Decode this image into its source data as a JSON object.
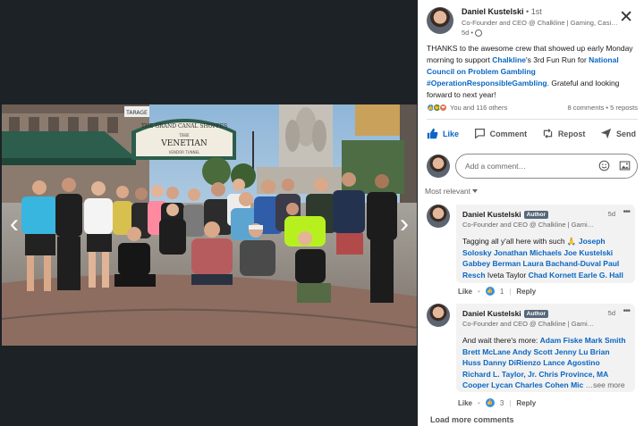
{
  "post": {
    "author_name": "Daniel Kustelski",
    "degree": "• 1st",
    "subtitle": "Co-Founder and CEO @ Chalkline | Gaming, Casino…",
    "time": "5d •",
    "text_1": "THANKS to the awesome crew that showed up early Monday morning to support ",
    "tag_company": "Chalkline",
    "text_2": "'s 3rd Fun Run for ",
    "tag_org": "National Council on Problem Gambling",
    "tag_hashtag": "#OperationResponsibleGambling",
    "text_3": ". Grateful and looking forward to next year!",
    "reactions_text": "You and 116 others",
    "counts_text": "8 comments • 5 reposts"
  },
  "actions": {
    "like": "Like",
    "comment": "Comment",
    "repost": "Repost",
    "send": "Send"
  },
  "composer": {
    "placeholder": "Add a comment…"
  },
  "sort_label": "Most relevant",
  "comments": [
    {
      "name": "Daniel Kustelski",
      "badge": "Author",
      "time": "5d",
      "subtitle": "Co-Founder and CEO @ Chalkline | Gaming…",
      "lead": "Tagging all y'all here with such 🙏 ",
      "tags_a": "Joseph Solosky Jonathan Michaels Joe Kustelski Gabbey Berman Laura Bachand-Duval Paul Resch",
      "plain": " Iveta Taylor ",
      "tags_b": "Chad Kornett Earle G. Hall",
      "like_label": "Like",
      "like_count": "1",
      "reply_label": "Reply"
    },
    {
      "name": "Daniel Kustelski",
      "badge": "Author",
      "time": "5d",
      "subtitle": "Co-Founder and CEO @ Chalkline | Gaming…",
      "lead": "And wait there's more: ",
      "tags_a": "Adam Fiske Mark Smith Brett McLane Andy Scott Jenny Lu Brian Huss Danny DiRienzo Lance Agostino Richard L. Taylor, Jr. Chris Province, MA Cooper Lycan Charles Cohen Mic",
      "see_more": "…see more",
      "like_label": "Like",
      "like_count": "3",
      "reply_label": "Reply"
    }
  ],
  "load_more": "Load more comments",
  "photo_sign": {
    "line1": "THE GRAND CANAL SHOPPES",
    "line2": "THE",
    "line3": "VENETIAN",
    "line4": "VENDOR TUNNEL"
  },
  "photo_store_sign": "TARAGE",
  "colors": {
    "link": "#0a66c2",
    "badge": "#56687a",
    "bg_dark": "#1b1f23"
  }
}
